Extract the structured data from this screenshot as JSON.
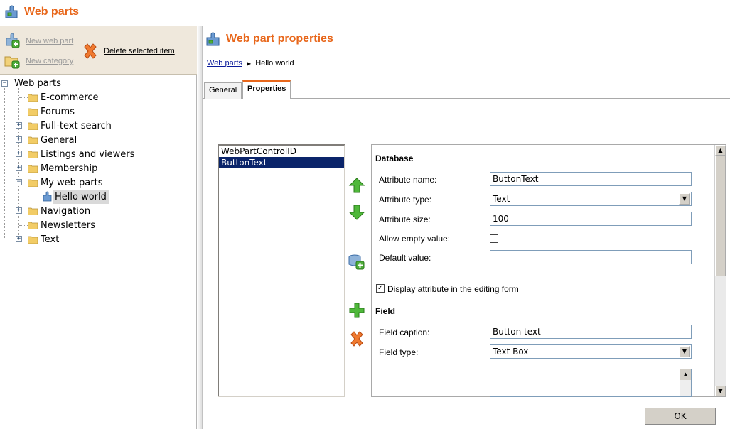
{
  "app": {
    "title": "Web parts",
    "icon": "puzzle-icon",
    "accent_color": "#e8671b"
  },
  "toolbar": {
    "new_web_part": "New web part",
    "new_category": "New category",
    "delete_selected": "Delete selected item"
  },
  "tree": {
    "root": "Web parts",
    "items": [
      {
        "label": "E-commerce"
      },
      {
        "label": "Forums"
      },
      {
        "label": "Full-text search"
      },
      {
        "label": "General"
      },
      {
        "label": "Listings and viewers"
      },
      {
        "label": "Membership"
      },
      {
        "label": "My web parts"
      },
      {
        "label": "Hello world"
      },
      {
        "label": "Navigation"
      },
      {
        "label": "Newsletters"
      },
      {
        "label": "Text"
      }
    ]
  },
  "panel": {
    "title": "Web part properties",
    "breadcrumb_link": "Web parts",
    "breadcrumb_current": "Hello world",
    "tabs": [
      "General",
      "Properties"
    ]
  },
  "attributes": {
    "items": [
      "WebPartControlID",
      "ButtonText"
    ],
    "selected": "ButtonText"
  },
  "form": {
    "database_title": "Database",
    "attribute_name_label": "Attribute name:",
    "attribute_name_value": "ButtonText",
    "attribute_type_label": "Attribute type:",
    "attribute_type_value": "Text",
    "attribute_size_label": "Attribute size:",
    "attribute_size_value": "100",
    "allow_empty_label": "Allow empty value:",
    "default_value_label": "Default value:",
    "default_value_value": "",
    "display_attribute_label": "Display attribute in the editing form",
    "field_title": "Field",
    "field_caption_label": "Field caption:",
    "field_caption_value": "Button text",
    "field_type_label": "Field type:",
    "field_type_value": "Text Box"
  },
  "ok_label": "OK"
}
